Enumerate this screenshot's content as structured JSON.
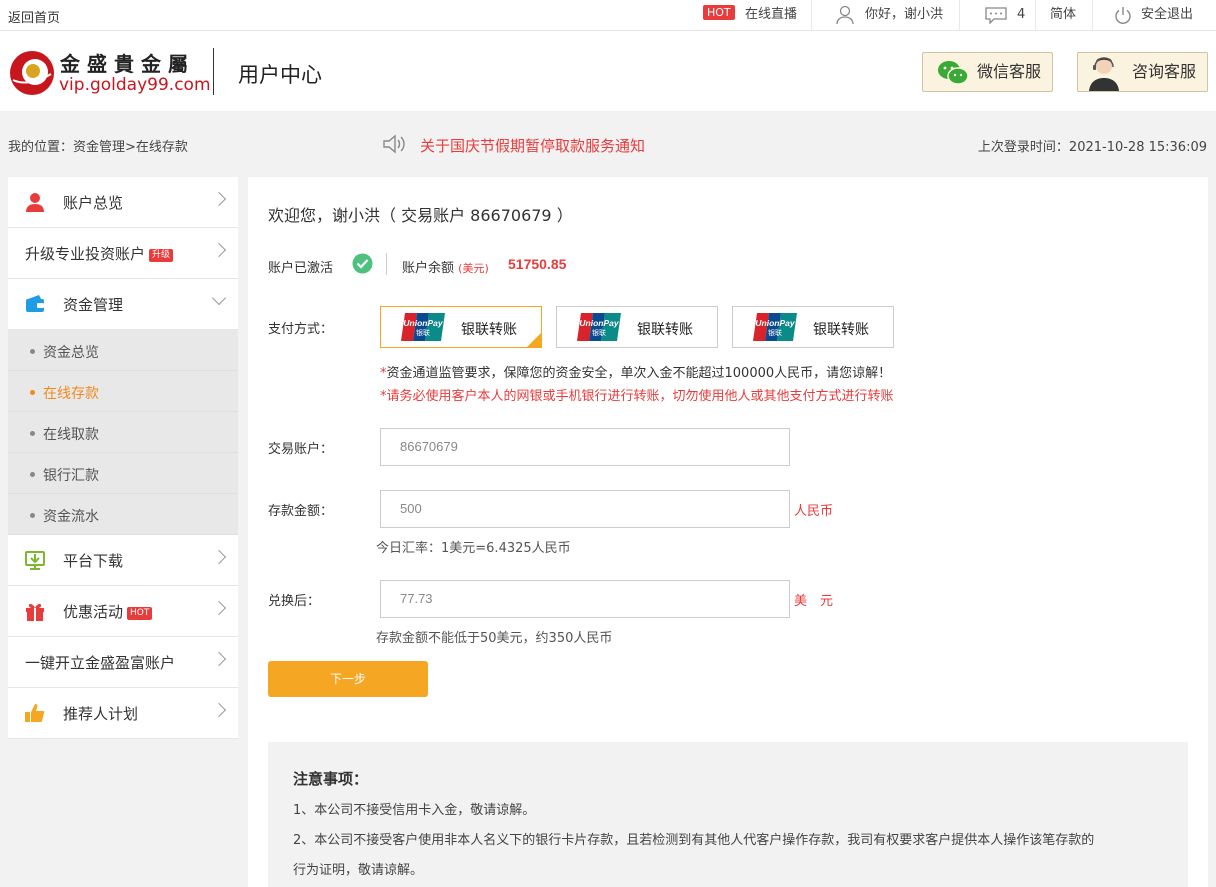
{
  "topbar": {
    "home": "返回首页",
    "hot_badge": "HOT",
    "live": "在线直播",
    "greeting": "你好，谢小洪",
    "messages": "4",
    "lang": "简体",
    "logout": "安全退出"
  },
  "header": {
    "brand_cn": "金盛貴金屬",
    "brand_url": "vip.golday99.com",
    "title": "用户中心",
    "wechat_service": "微信客服",
    "consult_service": "咨询客服"
  },
  "crumb": {
    "path": "我的位置：资金管理>在线存款",
    "notice": "关于国庆节假期暂停取款服务通知",
    "last_login": "上次登录时间：2021-10-28 15:36:09"
  },
  "sidebar": {
    "overview": "账户总览",
    "upgrade": "升级专业投资账户",
    "upgrade_badge": "升级",
    "funds": "资金管理",
    "sub": [
      "资金总览",
      "在线存款",
      "在线取款",
      "银行汇款",
      "资金流水"
    ],
    "download": "平台下载",
    "promo": "优惠活动",
    "promo_badge": "HOT",
    "open_account": "一键开立金盛盈富账户",
    "referral": "推荐人计划"
  },
  "main": {
    "welcome": "欢迎您，谢小洪（  交易账户  86670679  ）",
    "activated": "账户已激活",
    "balance_label": "账户余额",
    "balance_unit": "(美元)",
    "balance_value": "51750.85",
    "pay_label": "支付方式：",
    "pay_options": [
      "银联转账",
      "银联转账",
      "银联转账"
    ],
    "unionpay_text": "UnionPay",
    "unionpay_cn": "银联",
    "notice1_star": "*",
    "notice1": "资金通道监管要求，保障您的资金安全，单次入金不能超过100000人民币，请您谅解！",
    "notice2": "*请务必使用客户本人的网银或手机银行进行转账，切勿使用他人或其他支付方式进行转账",
    "account_label": "交易账户：",
    "account_value": "86670679",
    "amount_label": "存款金额：",
    "amount_value": "500",
    "amount_unit": "人民币",
    "rate_text": "今日汇率：1美元=6.4325人民币",
    "converted_label": "兑换后：",
    "converted_value": "77.73",
    "converted_unit": "美　元",
    "min_text": "存款金额不能低于50美元，约350人民币",
    "next_button": "下一步"
  },
  "notes": {
    "title": "注意事项：",
    "items": [
      "1、本公司不接受信用卡入金，敬请谅解。",
      "2、本公司不接受客户使用非本人名义下的银行卡片存款，且若检测到有其他人代客户操作存款，我司有权要求客户提供本人操作该笔存款的",
      "行为证明，敬请谅解。"
    ]
  },
  "colors": {
    "accent": "#f5a623",
    "red": "#e83c3c",
    "active_link": "#f08a1e"
  }
}
